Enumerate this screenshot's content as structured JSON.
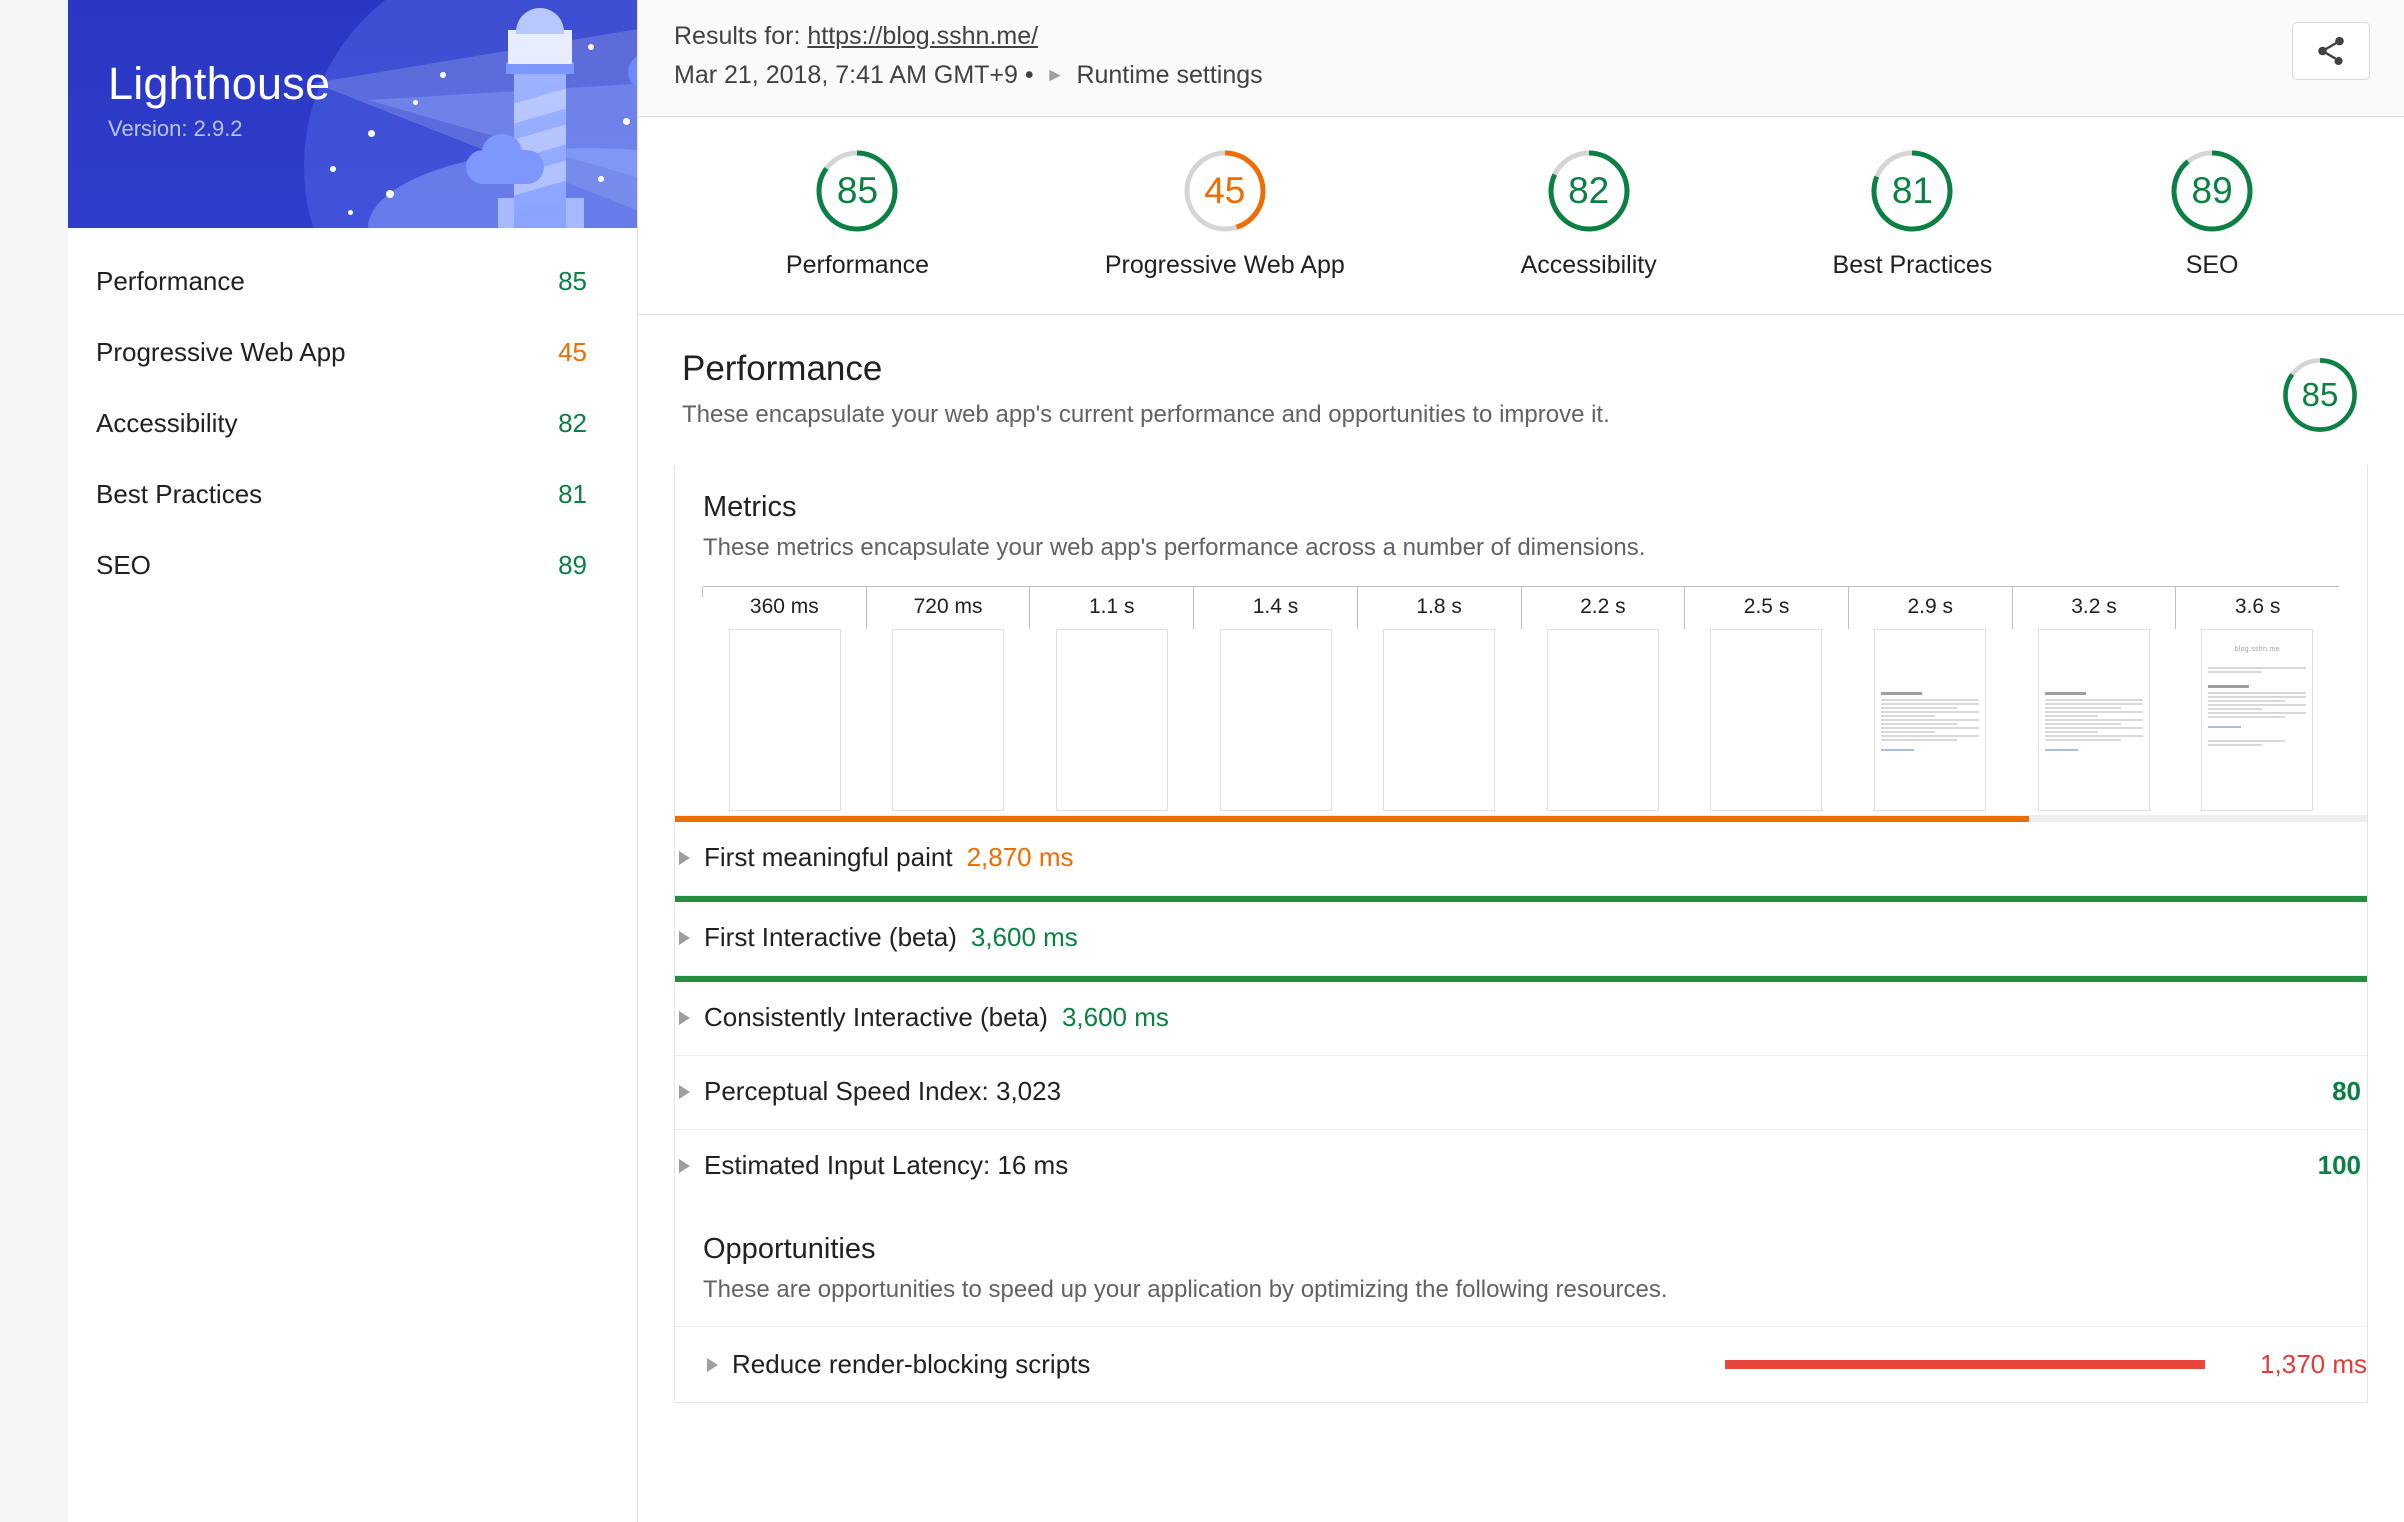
{
  "brand": {
    "title": "Lighthouse",
    "version": "Version: 2.9.2"
  },
  "sidebar": {
    "items": [
      {
        "label": "Performance",
        "score": "85",
        "color": "green"
      },
      {
        "label": "Progressive Web App",
        "score": "45",
        "color": "orange"
      },
      {
        "label": "Accessibility",
        "score": "82",
        "color": "green"
      },
      {
        "label": "Best Practices",
        "score": "81",
        "color": "green"
      },
      {
        "label": "SEO",
        "score": "89",
        "color": "green"
      }
    ]
  },
  "header": {
    "results_prefix": "Results for:",
    "url": "https://blog.sshn.me/",
    "timestamp": "Mar 21, 2018, 7:41 AM GMT+9 •",
    "runtime_settings": "Runtime settings",
    "share_icon": "share-icon"
  },
  "gauges": [
    {
      "score": "85",
      "label": "Performance",
      "color": "#0b8043",
      "percent": 85
    },
    {
      "score": "45",
      "label": "Progressive Web App",
      "color": "#ef6c00",
      "percent": 45
    },
    {
      "score": "82",
      "label": "Accessibility",
      "color": "#0b8043",
      "percent": 82
    },
    {
      "score": "81",
      "label": "Best Practices",
      "color": "#0b8043",
      "percent": 81
    },
    {
      "score": "89",
      "label": "SEO",
      "color": "#0b8043",
      "percent": 89
    }
  ],
  "performance": {
    "title": "Performance",
    "description": "These encapsulate your web app's current performance and opportunities to improve it.",
    "score": "85",
    "percent": 85,
    "color": "#0b8043"
  },
  "metrics_section": {
    "title": "Metrics",
    "description": "These metrics encapsulate your web app's performance across a number of dimensions.",
    "filmstrip_ticks": [
      "360 ms",
      "720 ms",
      "1.1 s",
      "1.4 s",
      "1.8 s",
      "2.2 s",
      "2.5 s",
      "2.9 s",
      "3.2 s",
      "3.6 s"
    ],
    "filmstrip_frames": [
      {
        "content": "blank"
      },
      {
        "content": "blank"
      },
      {
        "content": "blank"
      },
      {
        "content": "blank"
      },
      {
        "content": "blank"
      },
      {
        "content": "blank"
      },
      {
        "content": "blank"
      },
      {
        "content": "text"
      },
      {
        "content": "text"
      },
      {
        "content": "full"
      }
    ],
    "filmstrip_last_title": "blog.sshn.me",
    "rows": [
      {
        "name": "First meaningful paint",
        "value": "2,870 ms",
        "value_color": "orange",
        "bar_color": "#ef6c00",
        "bar_percent": 80,
        "has_bar": true,
        "score": ""
      },
      {
        "name": "First Interactive (beta)",
        "value": "3,600 ms",
        "value_color": "green",
        "bar_color": "#2a8a3e",
        "bar_percent": 100,
        "has_bar": true,
        "score": ""
      },
      {
        "name": "Consistently Interactive (beta)",
        "value": "3,600 ms",
        "value_color": "green",
        "bar_color": "#2a8a3e",
        "bar_percent": 100,
        "has_bar": true,
        "score": ""
      },
      {
        "name": "Perceptual Speed Index: 3,023",
        "value": "",
        "value_color": "green",
        "bar_color": "",
        "bar_percent": 0,
        "has_bar": false,
        "score": "80"
      },
      {
        "name": "Estimated Input Latency: 16 ms",
        "value": "",
        "value_color": "green",
        "bar_color": "",
        "bar_percent": 0,
        "has_bar": false,
        "score": "100"
      }
    ]
  },
  "opportunities_section": {
    "title": "Opportunities",
    "description": "These are opportunities to speed up your application by optimizing the following resources.",
    "rows": [
      {
        "name": "Reduce render-blocking scripts",
        "value": "1,370 ms",
        "bar_color": "#e8453c",
        "bar_percent": 100
      }
    ]
  }
}
